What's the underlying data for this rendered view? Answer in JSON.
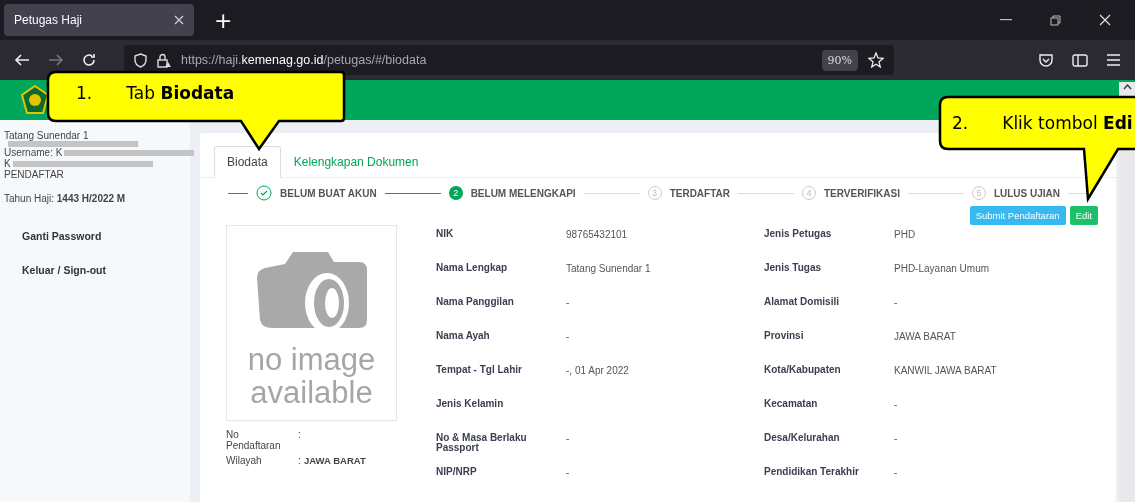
{
  "browser": {
    "tab_title": "Petugas Haji",
    "new_tab": "+",
    "url_prefix": "https://haji.",
    "url_domain": "kemenag.go.id",
    "url_path": "/petugas/#/biodata",
    "zoom": "90%"
  },
  "sidebar": {
    "name": "Tatang Sunendar 1",
    "username": "Username: K",
    "line_3": "K",
    "role": "PENDAFTAR",
    "year_label": "Tahun Haji: ",
    "year_value": "1443 H/2022 M",
    "menu": [
      {
        "label": "Ganti Password"
      },
      {
        "label": "Keluar / Sign-out"
      }
    ]
  },
  "tabs": [
    {
      "label": "Biodata",
      "selected": true
    },
    {
      "label": "Kelengkapan Dokumen",
      "selected": false
    }
  ],
  "steps": [
    {
      "label": "BELUM BUAT AKUN",
      "kind": "done"
    },
    {
      "number": "2",
      "label": "BELUM MELENGKAPI",
      "kind": "active"
    },
    {
      "number": "3",
      "label": "TERDAFTAR",
      "kind": "pending"
    },
    {
      "number": "4",
      "label": "TERVERIFIKASI",
      "kind": "pending"
    },
    {
      "number": "5",
      "label": "LULUS UJIAN",
      "kind": "pending"
    }
  ],
  "buttons": [
    {
      "label": "Submit Pendaftaran",
      "kind": "info"
    },
    {
      "label": "Edit",
      "kind": "success"
    }
  ],
  "photo": {
    "line_1": "no image",
    "line_2": "available"
  },
  "registration": [
    {
      "label": "No Pendaftaran",
      "separator": ":"
    },
    {
      "label": "Wilayah",
      "separator": ":",
      "value": "JAWA BARAT"
    }
  ],
  "fields_left": [
    {
      "label": "NIK",
      "value": "98765432101"
    },
    {
      "label": "Nama Lengkap",
      "value": "Tatang Sunendar 1"
    },
    {
      "label": "Nama Panggilan",
      "value": "-"
    },
    {
      "label": "Nama Ayah",
      "value": "-"
    },
    {
      "label": "Tempat - Tgl Lahir",
      "value": "-, 01 Apr 2022"
    },
    {
      "label": "Jenis Kelamin"
    },
    {
      "label": "No & Masa Berlaku Passport",
      "value": "-"
    },
    {
      "label": "NIP/NRP",
      "value": "-"
    }
  ],
  "fields_right": [
    {
      "label": "Jenis Petugas",
      "value": "PHD"
    },
    {
      "label": "Jenis Tugas",
      "value": "PHD-Layanan Umum"
    },
    {
      "label": "Alamat Domisili",
      "value": "-"
    },
    {
      "label": "Provinsi",
      "value": "JAWA BARAT"
    },
    {
      "label": "Kota/Kabupaten",
      "value": "KANWIL JAWA BARAT"
    },
    {
      "label": "Kecamatan",
      "value": "-"
    },
    {
      "label": "Desa/Kelurahan",
      "value": "-"
    },
    {
      "label": "Pendidikan Terakhir",
      "value": "-"
    }
  ],
  "callouts": [
    {
      "number": "1.",
      "text": "Tab **Biodata**"
    },
    {
      "number": "2.",
      "text": "Klik tombol **Edi**"
    }
  ]
}
